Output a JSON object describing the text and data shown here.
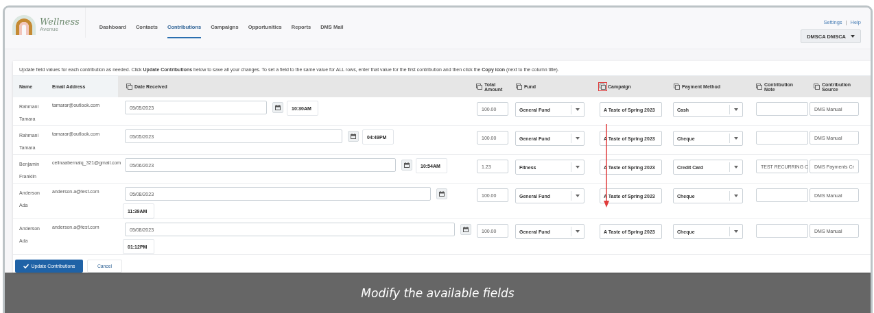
{
  "brand": {
    "name": "Wellness",
    "sub": "Avenue"
  },
  "nav": [
    {
      "label": "Dashboard",
      "selected": false
    },
    {
      "label": "Contacts",
      "selected": false
    },
    {
      "label": "Contributions",
      "selected": true
    },
    {
      "label": "Campaigns",
      "selected": false
    },
    {
      "label": "Opportunities",
      "selected": false
    },
    {
      "label": "Reports",
      "selected": false
    },
    {
      "label": "DMS Mail",
      "selected": false
    }
  ],
  "header_links": [
    "Settings",
    "Help"
  ],
  "header_link_separator": "|",
  "user_menu": "DMSCA DMSCA",
  "instructions": "Update field values for each contribution as needed. Click **Update Contributions** below to save all your changes. To set a field to the same value for ALL rows, enter that value for the first contribution and then click the **Copy icon** (next to the column title).",
  "columns": [
    {
      "label": "Name",
      "copy_icon": false
    },
    {
      "label": "Email Address",
      "copy_icon": false
    },
    {
      "label": "Date Received",
      "copy_icon": true,
      "highlighted": false
    },
    {
      "label": "Total Amount",
      "copy_icon": true,
      "highlighted": false
    },
    {
      "label": "Fund",
      "copy_icon": true,
      "highlighted": false
    },
    {
      "label": "Campaign",
      "copy_icon": true,
      "highlighted": true
    },
    {
      "label": "Payment Method",
      "copy_icon": true,
      "highlighted": false
    },
    {
      "label": "Contribution Note",
      "copy_icon": true,
      "highlighted": false
    },
    {
      "label": "Contribution Source",
      "copy_icon": true,
      "highlighted": false
    }
  ],
  "rows": [
    {
      "name": "Rahmani Tamara",
      "email": "tamarar@outlook.com",
      "date": "05/05/2023",
      "time": "10:30AM",
      "amount": "100.00",
      "fund": "General Fund",
      "campaign": "A Taste of Spring 2023",
      "payment_method": "Cash",
      "note": "",
      "source": "DMS Manual"
    },
    {
      "name": "Rahmani Tamara",
      "email": "tamarar@outlook.com",
      "date": "05/05/2023",
      "time": "04:49PM",
      "amount": "100.00",
      "fund": "General Fund",
      "campaign": "A Taste of Spring 2023",
      "payment_method": "Cheque",
      "note": "",
      "source": "DMS Manual"
    },
    {
      "name": "Benjamin Franklin",
      "email": "celinaabernalq_321@gmail.com",
      "date": "05/06/2023",
      "time": "10:54AM",
      "amount": "1.23",
      "fund": "Fitness",
      "campaign": "A Taste of Spring 2023",
      "payment_method": "Credit Card",
      "note": "TEST RECURRING C",
      "source": "DMS Payments Cr"
    },
    {
      "name": "Anderson Ada",
      "email": "anderson.a@test.com",
      "date": "05/08/2023",
      "time": "11:39AM",
      "amount": "100.00",
      "fund": "General Fund",
      "campaign": "A Taste of Spring 2023",
      "payment_method": "Cheque",
      "note": "",
      "source": "DMS Manual"
    },
    {
      "name": "Anderson Ada",
      "email": "anderson.a@test.com",
      "date": "05/08/2023",
      "time": "01:12PM",
      "amount": "100.00",
      "fund": "General Fund",
      "campaign": "A Taste of Spring 2023",
      "payment_method": "Cheque",
      "note": "",
      "source": "DMS Manual"
    }
  ],
  "buttons": {
    "primary": "Update Contributions",
    "secondary": "Cancel"
  },
  "caption": "Modify the available fields"
}
